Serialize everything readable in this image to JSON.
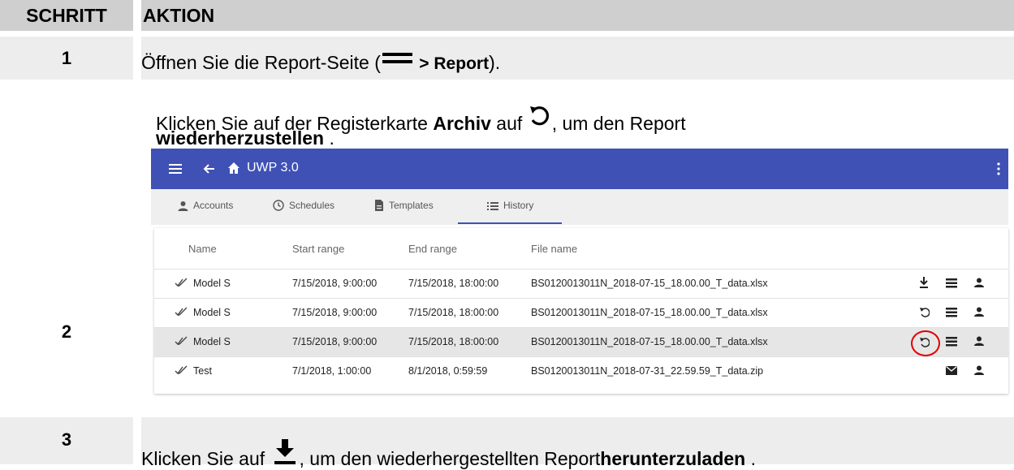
{
  "header": {
    "col_step": "SCHRITT",
    "col_action": "AKTION"
  },
  "steps": [
    {
      "number": "1",
      "text_before": "Öffnen Sie die Report-Seite (",
      "menu_target": "> Report",
      "text_after": ")."
    },
    {
      "number": "2",
      "line1_before": "Klicken Sie auf der Registerkarte ",
      "tab_name": "Archiv",
      "line1_mid": " auf ",
      "line1_after": ", um den Report",
      "line2": "wiederherzustellen",
      "line2_after": " ."
    },
    {
      "number": "3",
      "text_before": "Klicken Sie auf ",
      "text_mid": ", um den wiederhergestellten Report",
      "bold_word": "herunterzuladen",
      "text_after": " ."
    }
  ],
  "app": {
    "title": "UWP 3.0",
    "accent_color": "#3f51b5",
    "tabs": [
      {
        "label": "Accounts",
        "icon": "person-icon"
      },
      {
        "label": "Schedules",
        "icon": "clock-icon"
      },
      {
        "label": "Templates",
        "icon": "document-icon"
      },
      {
        "label": "History",
        "icon": "list-icon",
        "active": true
      }
    ],
    "columns": [
      "Name",
      "Start range",
      "End range",
      "File name"
    ],
    "rows": [
      {
        "name": "Model S",
        "start": "7/15/2018, 9:00:00",
        "end": "7/15/2018, 18:00:00",
        "file": "BS0120013011N_2018-07-15_18.00.00_T_data.xlsx",
        "actions": [
          "download-icon",
          "list-icon",
          "person-icon"
        ]
      },
      {
        "name": "Model S",
        "start": "7/15/2018, 9:00:00",
        "end": "7/15/2018, 18:00:00",
        "file": "BS0120013011N_2018-07-15_18.00.00_T_data.xlsx",
        "actions": [
          "restore-icon",
          "list-icon",
          "person-icon"
        ]
      },
      {
        "name": "Model S",
        "start": "7/15/2018, 9:00:00",
        "end": "7/15/2018, 18:00:00",
        "file": "BS0120013011N_2018-07-15_18.00.00_T_data.xlsx",
        "actions": [
          "restore-icon",
          "list-icon",
          "person-icon"
        ],
        "highlighted": true
      },
      {
        "name": "Test",
        "start": "7/1/2018, 1:00:00",
        "end": "8/1/2018, 0:59:59",
        "file": "BS0120013011N_2018-07-31_22.59.59_T_data.zip",
        "actions": [
          "mail-icon",
          "person-icon"
        ]
      }
    ]
  }
}
